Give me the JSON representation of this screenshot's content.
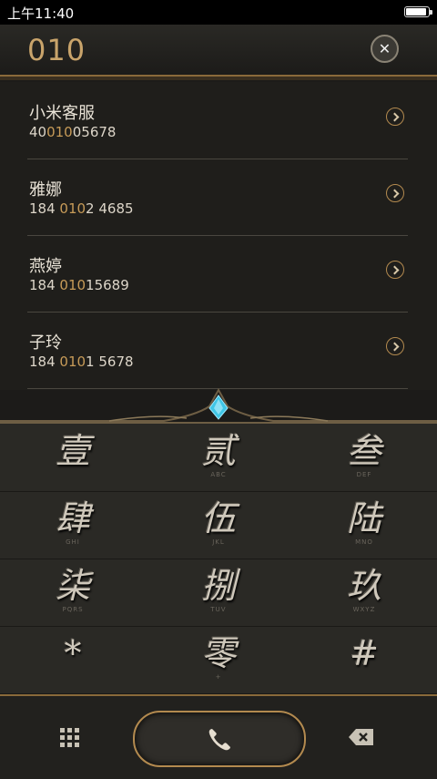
{
  "status_bar": {
    "time": "上午11:40",
    "battery_level": 0.9
  },
  "search": {
    "query": "010"
  },
  "results": [
    {
      "name": "小米客服",
      "number_pre": "40",
      "number_match": "010",
      "number_post": "05678"
    },
    {
      "name": "雅娜",
      "number_pre": "184 ",
      "number_match": "010",
      "number_post": "2 4685"
    },
    {
      "name": "燕婷",
      "number_pre": "184 ",
      "number_match": "010",
      "number_post": "15689"
    },
    {
      "name": "子玲",
      "number_pre": "184 ",
      "number_match": "010",
      "number_post": "1 5678"
    }
  ],
  "keypad": {
    "keys": [
      {
        "glyph": "壹",
        "sub": ""
      },
      {
        "glyph": "贰",
        "sub": "ABC"
      },
      {
        "glyph": "叁",
        "sub": "DEF"
      },
      {
        "glyph": "肆",
        "sub": "GHI"
      },
      {
        "glyph": "伍",
        "sub": "JKL"
      },
      {
        "glyph": "陆",
        "sub": "MNO"
      },
      {
        "glyph": "柒",
        "sub": "PQRS"
      },
      {
        "glyph": "捌",
        "sub": "TUV"
      },
      {
        "glyph": "玖",
        "sub": "WXYZ"
      },
      {
        "glyph": "*",
        "sub": ""
      },
      {
        "glyph": "零",
        "sub": "+"
      },
      {
        "glyph": "#",
        "sub": ""
      }
    ]
  },
  "colors": {
    "match_highlight": "#c79b58",
    "gold_border": "#b38a4f",
    "background": "#1c1b19"
  }
}
